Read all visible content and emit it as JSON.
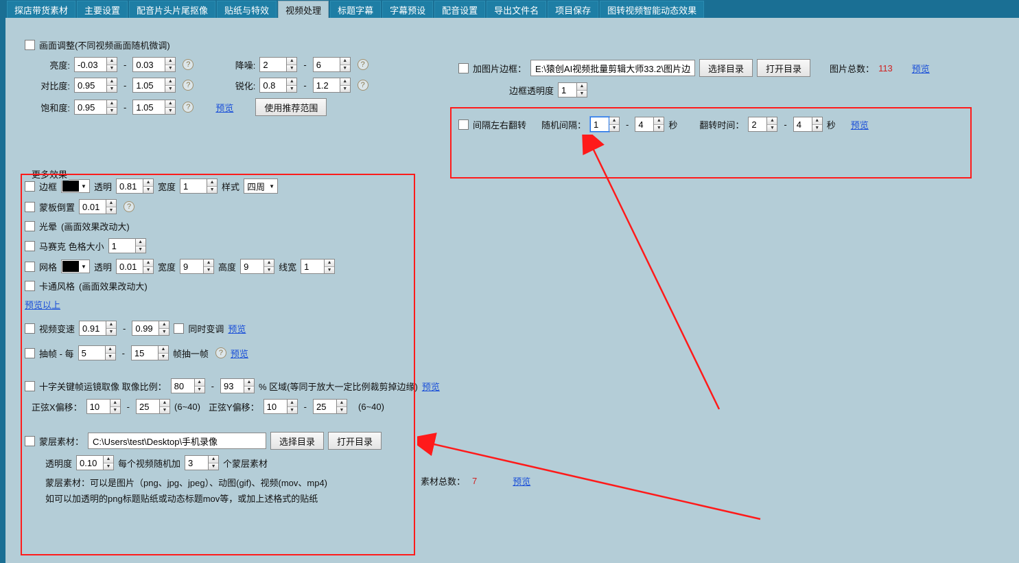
{
  "tabs": [
    "探店带货素材",
    "主要设置",
    "配音片头片尾抠像",
    "贴纸与特效",
    "视频处理",
    "标题字幕",
    "字幕预设",
    "配音设置",
    "导出文件名",
    "项目保存",
    "图转视频智能动态效果"
  ],
  "active_tab_index": 4,
  "image_adjust": {
    "checkbox_label": "画面调整(不同视频画面随机微调)",
    "brightness_label": "亮度:",
    "brightness_from": "-0.03",
    "brightness_to": "0.03",
    "denoise_label": "降噪:",
    "denoise_from": "2",
    "denoise_to": "6",
    "contrast_label": "对比度:",
    "contrast_from": "0.95",
    "contrast_to": "1.05",
    "sharpen_label": "锐化:",
    "sharpen_from": "0.8",
    "sharpen_to": "1.2",
    "saturation_label": "饱和度:",
    "saturation_from": "0.95",
    "saturation_to": "1.05",
    "preview_link": "预览",
    "recommend_btn": "使用推荐范围"
  },
  "more_title": "更多效果",
  "border": {
    "label": "边框",
    "opacity_label": "透明",
    "opacity": "0.81",
    "width_label": "宽度",
    "width": "1",
    "style_label": "样式",
    "style_value": "四周"
  },
  "mask_invert": {
    "label": "蒙板倒置",
    "value": "0.01"
  },
  "halo": {
    "label": "光晕",
    "note": "(画面效果改动大)"
  },
  "mosaic": {
    "label": "马赛克 色格大小",
    "value": "1"
  },
  "grid": {
    "label": "网格",
    "opacity_label": "透明",
    "opacity": "0.01",
    "width_label": "宽度",
    "width": "9",
    "height_label": "高度",
    "height": "9",
    "linewidth_label": "线宽",
    "linewidth": "1"
  },
  "cartoon": {
    "label": "卡通风格",
    "note": "(画面效果改动大)"
  },
  "preview_above": "预览以上",
  "speed": {
    "label": "视频变速",
    "from": "0.91",
    "to": "0.99",
    "sync_label": "同时变调",
    "preview": "预览"
  },
  "frame_drop": {
    "label": "抽帧 - 每",
    "from": "5",
    "to": "15",
    "unit": "帧抽一帧",
    "preview": "预览"
  },
  "keyframe": {
    "label": "十字关键帧运镜取像 取像比例：",
    "from": "80",
    "to": "93",
    "suffix": "%  区域(等同于放大一定比例裁剪掉边缘)",
    "preview": "预览",
    "sinx_label": "正弦X偏移：",
    "sinx_from": "10",
    "sinx_to": "25",
    "sinx_range": "(6~40)",
    "siny_label": "正弦Y偏移：",
    "siny_from": "10",
    "siny_to": "25",
    "siny_range": "(6~40)"
  },
  "overlay": {
    "label": "蒙层素材：",
    "path": "C:\\Users\\test\\Desktop\\手机录像",
    "choose_btn": "选择目录",
    "open_btn": "打开目录",
    "count_label": "素材总数：",
    "count": "7",
    "preview": "预览",
    "opacity_label": "透明度",
    "opacity": "0.10",
    "per_video_label_a": "每个视频随机加",
    "per_video_value": "3",
    "per_video_label_b": "个蒙层素材",
    "note1": "蒙层素材：可以是图片（png、jpg、jpeg）、动图(gif)、视频(mov、mp4)",
    "note2": "如可以加透明的png标题贴纸或动态标题mov等，或加上述格式的贴纸"
  },
  "pic_border": {
    "label": "加图片边框：",
    "path": "E:\\猿创AI视频批量剪辑大师33.2\\图片边",
    "choose_btn": "选择目录",
    "open_btn": "打开目录",
    "count_label": "图片总数：",
    "count": "113",
    "preview": "预览",
    "opacity_label": "边框透明度",
    "opacity": "1"
  },
  "flip": {
    "label": "间隔左右翻转",
    "random_label": "随机间隔：",
    "random_from": "1",
    "random_to": "4",
    "sec": "秒",
    "time_label": "翻转时间：",
    "time_from": "2",
    "time_to": "4",
    "sec2": "秒",
    "preview": "预览"
  }
}
